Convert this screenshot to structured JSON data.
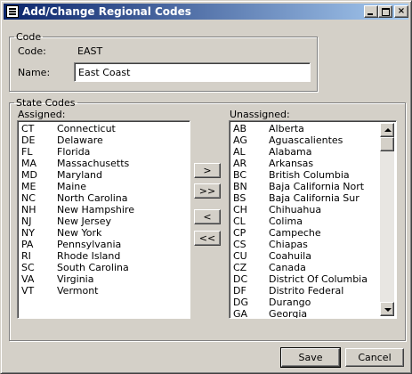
{
  "window": {
    "title": "Add/Change Regional Codes",
    "controls": [
      "minimize",
      "maximize",
      "close"
    ],
    "close_glyph": "×"
  },
  "code_group": {
    "legend": "Code",
    "code_label": "Code:",
    "code_value": "EAST",
    "name_label": "Name:",
    "name_value": "East Coast"
  },
  "state_group": {
    "legend": "State Codes",
    "assigned_label": "Assigned:",
    "unassigned_label": "Unassigned:",
    "assigned": [
      {
        "abbr": "CT",
        "name": "Connecticut"
      },
      {
        "abbr": "DE",
        "name": "Delaware"
      },
      {
        "abbr": "FL",
        "name": "Florida"
      },
      {
        "abbr": "MA",
        "name": "Massachusetts"
      },
      {
        "abbr": "MD",
        "name": "Maryland"
      },
      {
        "abbr": "ME",
        "name": "Maine"
      },
      {
        "abbr": "NC",
        "name": "North Carolina"
      },
      {
        "abbr": "NH",
        "name": "New Hampshire"
      },
      {
        "abbr": "NJ",
        "name": "New Jersey"
      },
      {
        "abbr": "NY",
        "name": "New York"
      },
      {
        "abbr": "PA",
        "name": "Pennsylvania"
      },
      {
        "abbr": "RI",
        "name": "Rhode Island"
      },
      {
        "abbr": "SC",
        "name": "South Carolina"
      },
      {
        "abbr": "VA",
        "name": "Virginia"
      },
      {
        "abbr": "VT",
        "name": "Vermont"
      }
    ],
    "unassigned": [
      {
        "abbr": "AB",
        "name": "Alberta"
      },
      {
        "abbr": "AG",
        "name": "Aguascalientes"
      },
      {
        "abbr": "AL",
        "name": "Alabama"
      },
      {
        "abbr": "AR",
        "name": "Arkansas"
      },
      {
        "abbr": "BC",
        "name": "British Columbia"
      },
      {
        "abbr": "BN",
        "name": "Baja California Nort"
      },
      {
        "abbr": "BS",
        "name": "Baja California Sur"
      },
      {
        "abbr": "CH",
        "name": "Chihuahua"
      },
      {
        "abbr": "CL",
        "name": "Colima"
      },
      {
        "abbr": "CP",
        "name": "Campeche"
      },
      {
        "abbr": "CS",
        "name": "Chiapas"
      },
      {
        "abbr": "CU",
        "name": "Coahuila"
      },
      {
        "abbr": "CZ",
        "name": "Canada"
      },
      {
        "abbr": "DC",
        "name": "District Of Columbia"
      },
      {
        "abbr": "DF",
        "name": "Distrito Federal"
      },
      {
        "abbr": "DG",
        "name": "Durango"
      },
      {
        "abbr": "GA",
        "name": "Georgia"
      }
    ],
    "move_buttons": {
      "add": ">",
      "add_all": ">>",
      "remove": "<",
      "remove_all": "<<"
    }
  },
  "footer": {
    "save": "Save",
    "cancel": "Cancel"
  }
}
